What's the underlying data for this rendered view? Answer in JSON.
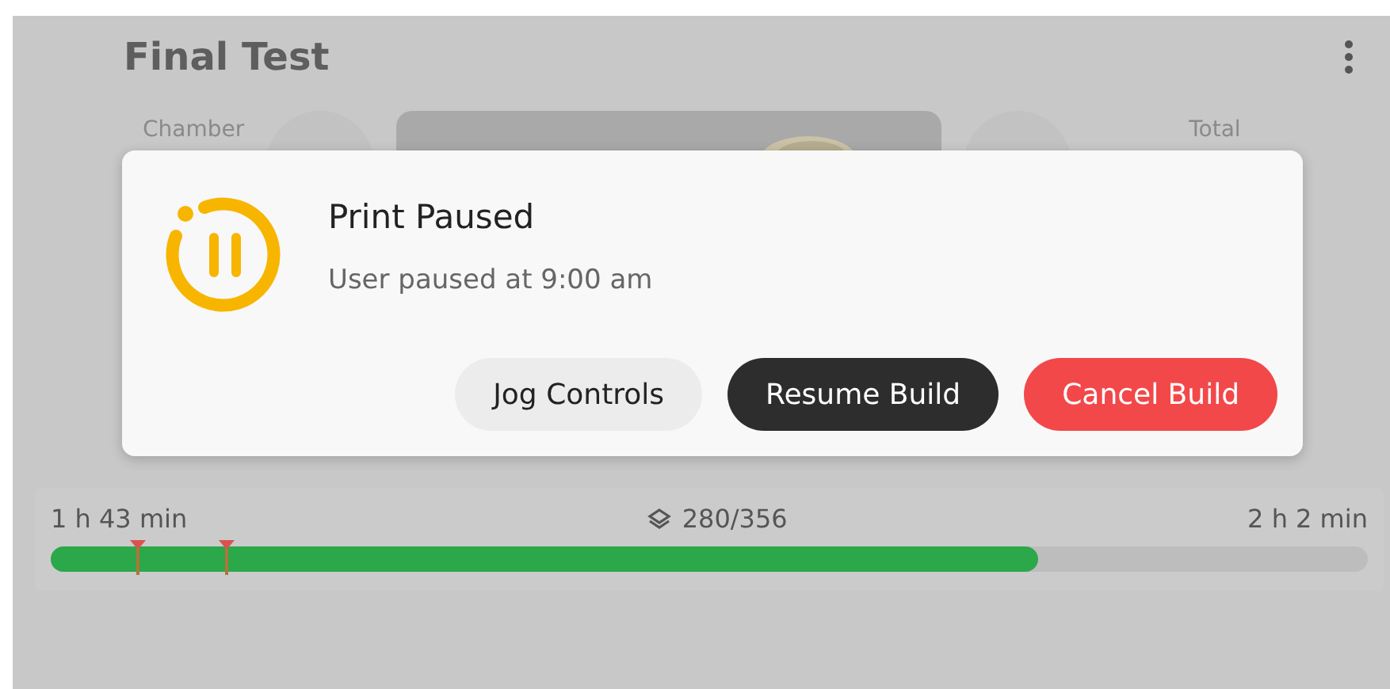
{
  "title": "Final Test",
  "stats": {
    "left_label": "Chamber",
    "right_label": "Total"
  },
  "dialog": {
    "title": "Print Paused",
    "message": "User paused at 9:00 am",
    "buttons": [
      {
        "label": "Jog Controls",
        "kind": "secondary"
      },
      {
        "label": "Resume Build",
        "kind": "primary"
      },
      {
        "label": "Cancel Build",
        "kind": "danger"
      }
    ]
  },
  "progress": {
    "elapsed": "1 h 43 min",
    "layers": "280/356",
    "remaining": "2 h 2 min",
    "level": 0.75
  }
}
